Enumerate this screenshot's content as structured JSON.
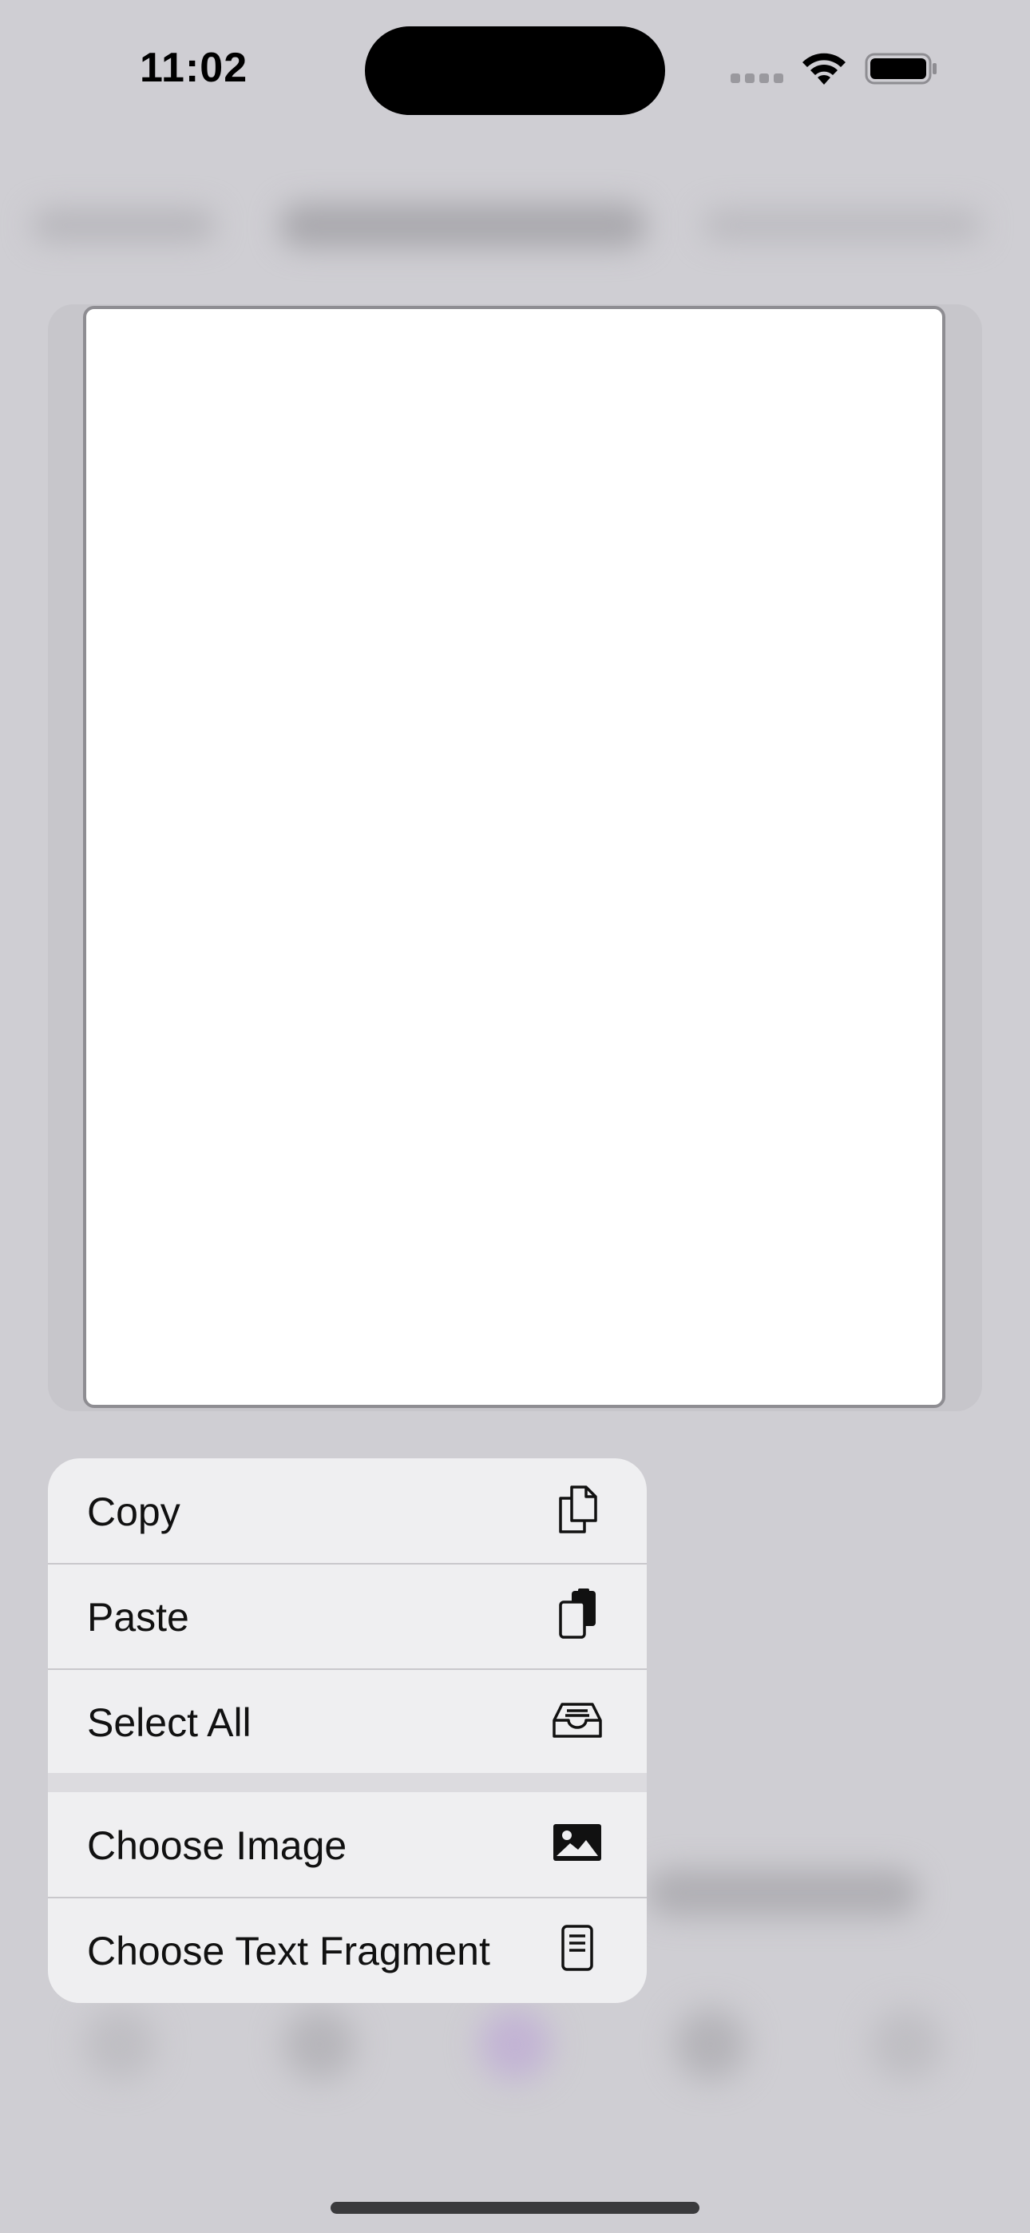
{
  "status_bar": {
    "time": "11:02",
    "wifi_icon": "wifi-icon",
    "battery_icon": "battery-full-icon",
    "cellular_icon": "cellular-dots-icon"
  },
  "context_menu": {
    "items": [
      {
        "label": "Copy",
        "icon": "copy-doc-icon"
      },
      {
        "label": "Paste",
        "icon": "paste-doc-icon"
      },
      {
        "label": "Select All",
        "icon": "tray-icon"
      },
      {
        "label": "Choose Image",
        "icon": "photo-icon"
      },
      {
        "label": "Choose Text Fragment",
        "icon": "text-document-icon"
      }
    ]
  },
  "colors": {
    "backdrop": "#cfced3",
    "menu_background": "#efeff1",
    "canvas": "#ffffff",
    "text": "#111111"
  }
}
